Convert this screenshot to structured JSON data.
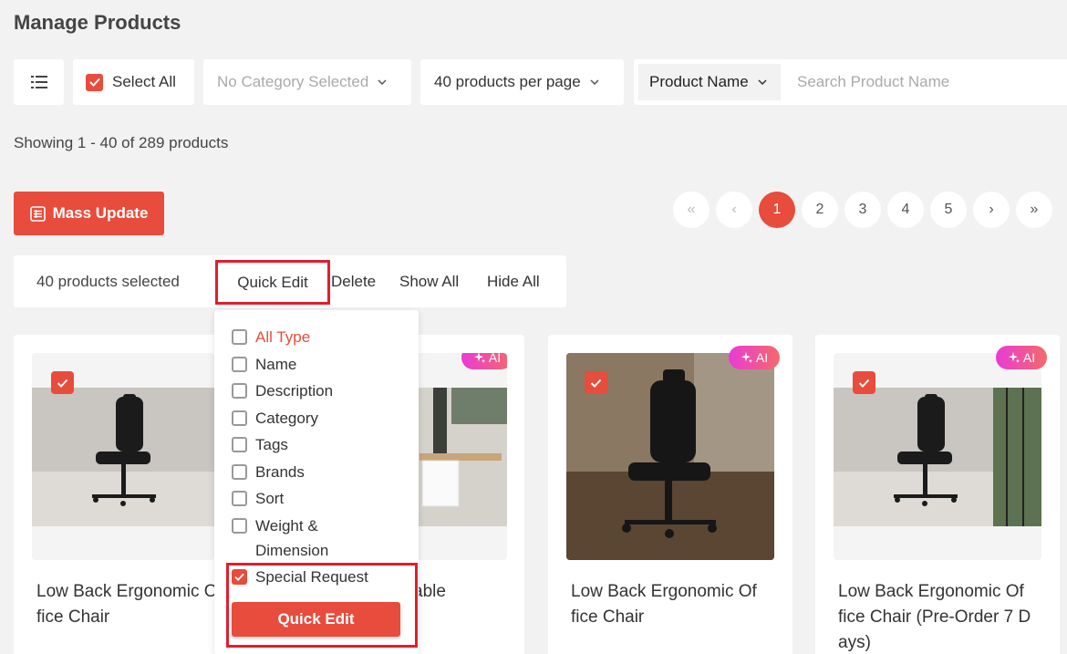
{
  "page": {
    "title": "Manage Products"
  },
  "toolbar": {
    "select_all_label": "Select All",
    "category_placeholder": "No Category Selected",
    "per_page_label": "40 products per page",
    "search_field_label": "Product Name",
    "search_placeholder": "Search Product Name"
  },
  "summary": {
    "showing_text": "Showing 1 - 40 of 289 products"
  },
  "mass_update": {
    "label": "Mass Update"
  },
  "pagination": {
    "first": "«",
    "prev": "‹",
    "pages": [
      "1",
      "2",
      "3",
      "4",
      "5"
    ],
    "next": "›",
    "last": "»",
    "current": "1"
  },
  "bulk_bar": {
    "count_text": "40 products selected",
    "quick_edit": "Quick Edit",
    "delete": "Delete",
    "show_all": "Show All",
    "hide_all": "Hide All"
  },
  "quick_edit_menu": {
    "items": [
      {
        "label": "All Type",
        "checked": false
      },
      {
        "label": "Name",
        "checked": false
      },
      {
        "label": "Description",
        "checked": false
      },
      {
        "label": "Category",
        "checked": false
      },
      {
        "label": "Tags",
        "checked": false
      },
      {
        "label": "Brands",
        "checked": false
      },
      {
        "label": "Sort",
        "checked": false
      },
      {
        "label": "Weight & Dimension",
        "line1": "Weight &",
        "line2": "Dimension",
        "checked": false
      },
      {
        "label": "Special Request",
        "checked": true
      }
    ],
    "button_label": "Quick Edit"
  },
  "products": [
    {
      "title_line1": "Low Back Ergonomic O",
      "title_line2": "fice Chair",
      "ai_badge": "",
      "selected": true
    },
    {
      "title_line1": "able",
      "title_line2": "",
      "ai_badge": "AI",
      "selected": true
    },
    {
      "title_line1": "Low Back Ergonomic Of",
      "title_line2": "fice Chair",
      "ai_badge": "AI",
      "selected": true
    },
    {
      "title_line1": "Low Back Ergonomic Of",
      "title_line2": "fice Chair (Pre-Order 7 D",
      "title_line3": "ays)",
      "ai_badge": "AI",
      "selected": true
    }
  ],
  "colors": {
    "accent": "#e74c3c",
    "highlight": "#e01e2e",
    "ai_gradient_start": "#e93bd6",
    "ai_gradient_end": "#f46a6a"
  }
}
